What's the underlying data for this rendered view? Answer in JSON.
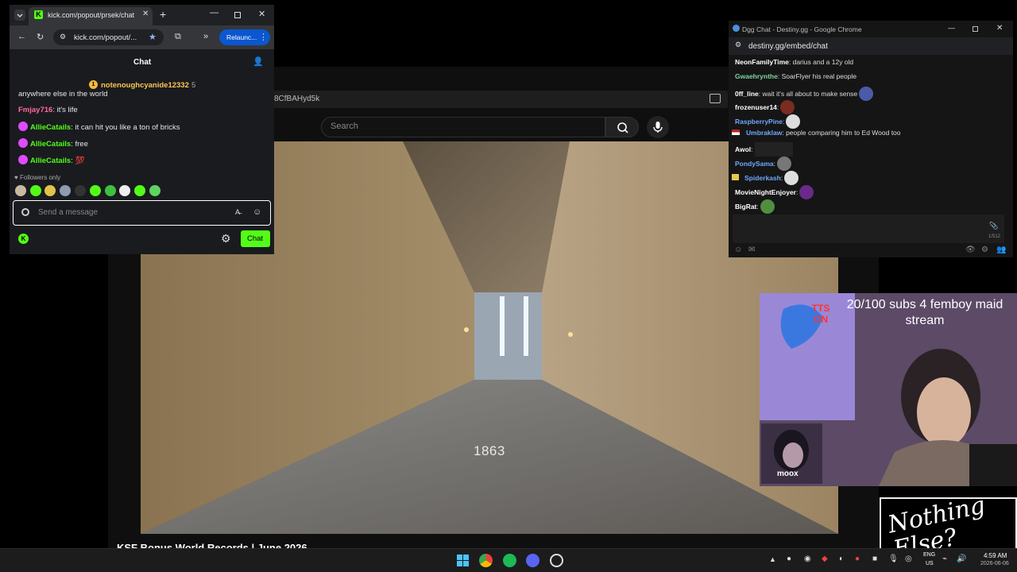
{
  "background_window": {
    "url_fragment": "8CfBAHyd5k",
    "search_placeholder": "Search",
    "video_overlay_text": "1863",
    "video_title": "KSF Bonus World Records | June 2026"
  },
  "kick_window": {
    "tab_title": "kick.com/popout/prsek/chat",
    "url": "kick.com/popout/...",
    "relaunch_label": "Relaunc...",
    "header_title": "Chat",
    "pinned_user": "notenoughcyanide12332",
    "pinned_count": "5",
    "messages": [
      {
        "user": "",
        "text": "anywhere else in the world",
        "color": "#e6e6e6"
      },
      {
        "user": "Fmjay716",
        "text": ": it's life",
        "color": "#ff6b9a"
      },
      {
        "user": "AllieCatails",
        "text": ": it can hit you like a ton of bricks",
        "color": "#53fc18"
      },
      {
        "user": "AllieCatails",
        "text": ": free",
        "color": "#53fc18"
      },
      {
        "user": "AllieCatails",
        "text": ": 💯",
        "color": "#53fc18"
      }
    ],
    "followers_only": "Followers only",
    "input_placeholder": "Send a message",
    "chat_button": "Chat"
  },
  "dgg_window": {
    "title": "Dgg Chat - Destiny.gg - Google Chrome",
    "url": "destiny.gg/embed/chat",
    "messages": [
      {
        "user": "NeonFamilyTime",
        "text": ": darius and a 12y old",
        "color": "#ffffff"
      },
      {
        "user": "Gwaehrynthe",
        "text": ": SoarFlyer his real people",
        "color": "#7dd3a0"
      },
      {
        "user": "0ff_line",
        "text": ": wait it's all about to make sense",
        "color": "#ffffff"
      },
      {
        "user": "frozenuser14",
        "text": ":",
        "color": "#ffffff"
      },
      {
        "user": "RaspberryPine",
        "text": ":",
        "color": "#6fa8ff"
      },
      {
        "user": "Umbraklaw",
        "text": ": people comparing him to Ed Wood too",
        "color": "#6fa8ff"
      },
      {
        "user": "Awol",
        "text": ":",
        "color": "#ffffff"
      },
      {
        "user": "PondySama",
        "text": ":",
        "color": "#6fa8ff"
      },
      {
        "user": "Spiderkash",
        "text": ":",
        "color": "#6fa8ff"
      },
      {
        "user": "MovieNightEnjoyer",
        "text": ":",
        "color": "#ffffff"
      },
      {
        "user": "BigRat",
        "text": ":",
        "color": "#ffffff"
      }
    ],
    "char_count": "1/512"
  },
  "webcam": {
    "goal_text": "20/100 subs 4 femboy maid stream",
    "tts_text": "TTS ON",
    "guest_name": "moox",
    "sign_text": "Nothing Else?"
  },
  "taskbar": {
    "lang_line1": "ENG",
    "lang_line2": "US",
    "time": "4:59 AM",
    "date": "2026-06-06"
  }
}
